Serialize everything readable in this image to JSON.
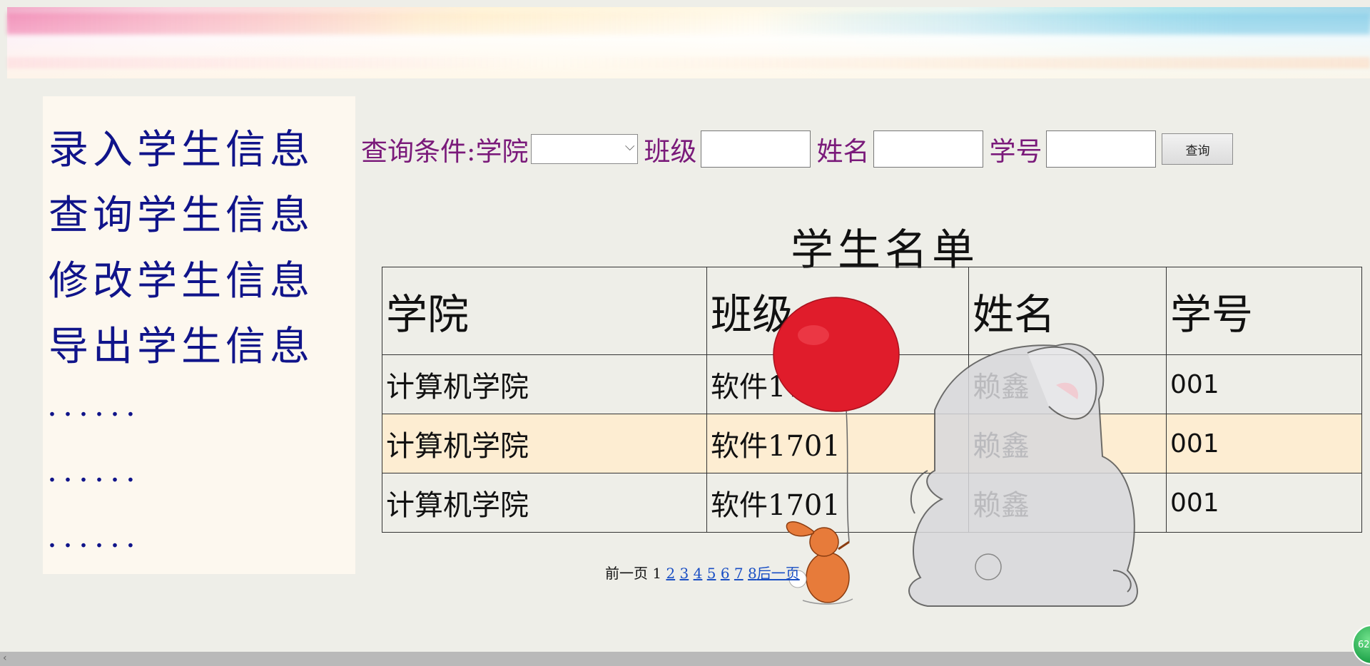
{
  "sidebar": {
    "items": [
      {
        "label": "录入学生信息"
      },
      {
        "label": "查询学生信息"
      },
      {
        "label": "修改学生信息"
      },
      {
        "label": "导出学生信息"
      }
    ],
    "placeholders": [
      "......",
      "......",
      "......"
    ]
  },
  "search": {
    "prefix_label": "查询条件:",
    "college_label": "学院",
    "college_value": "",
    "class_label": "班级",
    "class_value": "",
    "name_label": "姓名",
    "name_value": "",
    "id_label": "学号",
    "id_value": "",
    "button_label": "查询"
  },
  "table": {
    "title": "学生名单",
    "headers": [
      "学院",
      "班级",
      "姓名",
      "学号"
    ],
    "rows": [
      [
        "计算机学院",
        "软件1701",
        "赖鑫",
        "001"
      ],
      [
        "计算机学院",
        "软件1701",
        "赖鑫",
        "001"
      ],
      [
        "计算机学院",
        "软件1701",
        "赖鑫",
        "001"
      ]
    ]
  },
  "pager": {
    "prev": "前一页",
    "current": "1",
    "pages": [
      "2",
      "3",
      "4",
      "5",
      "6",
      "7",
      "8"
    ],
    "next": "后一页"
  },
  "badge": {
    "text": "62"
  },
  "colors": {
    "menu": "#10148a",
    "search_label": "#7a1a7a",
    "link": "#1a4fc4",
    "highlight_row": "#ffecce"
  }
}
